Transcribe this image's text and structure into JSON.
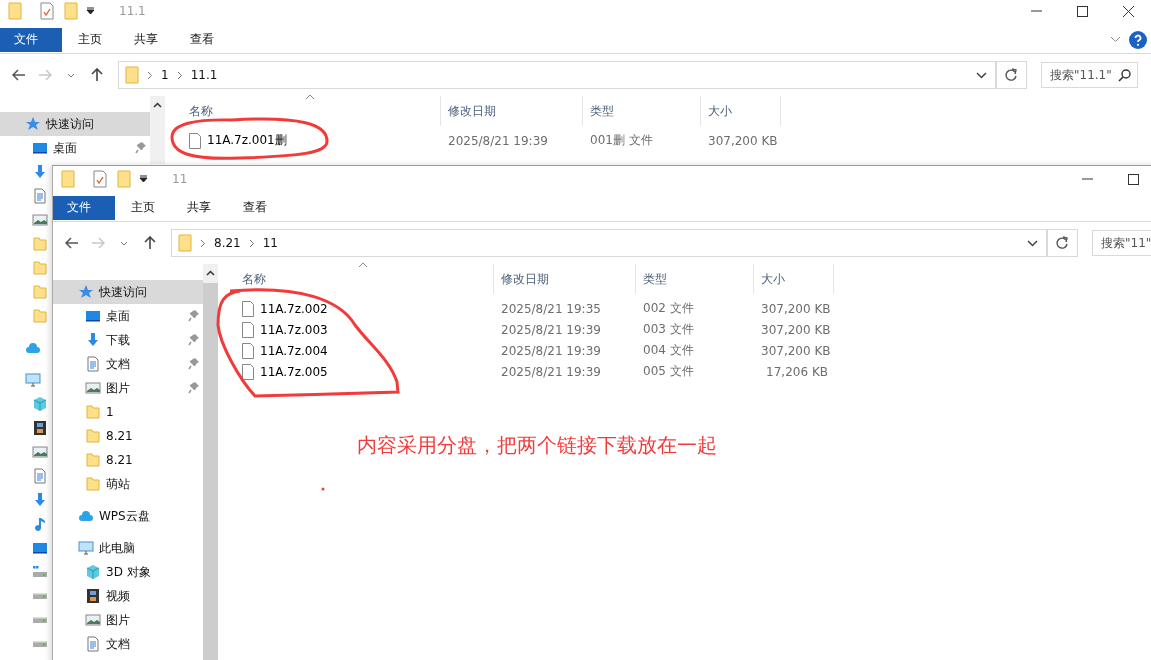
{
  "windows": [
    {
      "title": "11.1",
      "ribbon_tabs": [
        {
          "label": "文件",
          "selected": true
        },
        {
          "label": "主页",
          "selected": false
        },
        {
          "label": "共享",
          "selected": false
        },
        {
          "label": "查看",
          "selected": false
        }
      ],
      "breadcrumbs": [
        "1",
        "11.1"
      ],
      "search": {
        "placeholder": "搜索\"11.1\""
      },
      "sidebar": [
        {
          "kind": "star",
          "label": "快速访问",
          "selected": true,
          "children": [
            {
              "kind": "desktop",
              "label": "桌面",
              "selected": false,
              "pinned": true
            },
            {
              "kind": "download",
              "selected": false
            },
            {
              "kind": "document",
              "selected": false
            },
            {
              "kind": "picture",
              "selected": false
            },
            {
              "kind": "folder",
              "selected": false
            },
            {
              "kind": "folder",
              "selected": false
            },
            {
              "kind": "folder",
              "selected": false
            },
            {
              "kind": "folder",
              "selected": false
            }
          ]
        },
        {
          "kind": "cloud",
          "selected": false
        },
        {
          "kind": "computer",
          "selected": false,
          "children": [
            {
              "kind": "cube",
              "selected": false
            },
            {
              "kind": "video",
              "selected": false
            },
            {
              "kind": "picture",
              "selected": false
            },
            {
              "kind": "document",
              "selected": false
            },
            {
              "kind": "download",
              "selected": false
            },
            {
              "kind": "music",
              "selected": false
            },
            {
              "kind": "desktop",
              "selected": false
            },
            {
              "kind": "system-drive",
              "selected": false
            },
            {
              "kind": "drive",
              "selected": false
            },
            {
              "kind": "drive",
              "selected": false
            },
            {
              "kind": "drive",
              "selected": false
            }
          ]
        }
      ],
      "columns": [
        "名称",
        "修改日期",
        "类型",
        "大小"
      ],
      "files": [
        {
          "name": "11A.7z.001删",
          "modified": "2025/8/21 19:39",
          "type": "001删 文件",
          "size": "307,200 KB"
        }
      ]
    },
    {
      "title": "11",
      "ribbon_tabs": [
        {
          "label": "文件",
          "selected": true
        },
        {
          "label": "主页",
          "selected": false
        },
        {
          "label": "共享",
          "selected": false
        },
        {
          "label": "查看",
          "selected": false
        }
      ],
      "breadcrumbs": [
        "8.21",
        "11"
      ],
      "search": {
        "placeholder": "搜索\"11\""
      },
      "sidebar": [
        {
          "kind": "star",
          "label": "快速访问",
          "selected": true,
          "children": [
            {
              "kind": "desktop",
              "label": "桌面",
              "selected": false,
              "pinned": true
            },
            {
              "kind": "download",
              "label": "下载",
              "selected": false,
              "pinned": true
            },
            {
              "kind": "document",
              "label": "文档",
              "selected": false,
              "pinned": true
            },
            {
              "kind": "picture",
              "label": "图片",
              "selected": false,
              "pinned": true
            },
            {
              "kind": "folder",
              "label": "1",
              "selected": false,
              "pinned": false
            },
            {
              "kind": "folder",
              "label": "8.21",
              "selected": false,
              "pinned": false
            },
            {
              "kind": "folder",
              "label": "8.21",
              "selected": false,
              "pinned": false
            },
            {
              "kind": "folder",
              "label": "萌站",
              "selected": false,
              "pinned": false
            }
          ]
        },
        {
          "kind": "cloud",
          "label": "WPS云盘",
          "selected": false
        },
        {
          "kind": "computer",
          "label": "此电脑",
          "selected": false,
          "children": [
            {
              "kind": "cube",
              "label": "3D 对象",
              "selected": false,
              "pinned": false
            },
            {
              "kind": "video",
              "label": "视频",
              "selected": false,
              "pinned": false
            },
            {
              "kind": "picture",
              "label": "图片",
              "selected": false,
              "pinned": false
            },
            {
              "kind": "document",
              "label": "文档",
              "selected": false,
              "pinned": false
            }
          ]
        }
      ],
      "columns": [
        "名称",
        "修改日期",
        "类型",
        "大小"
      ],
      "files": [
        {
          "name": "11A.7z.002",
          "modified": "2025/8/21 19:35",
          "type": "002 文件",
          "size": "307,200 KB"
        },
        {
          "name": "11A.7z.003",
          "modified": "2025/8/21 19:39",
          "type": "003 文件",
          "size": "307,200 KB"
        },
        {
          "name": "11A.7z.004",
          "modified": "2025/8/21 19:39",
          "type": "004 文件",
          "size": "307,200 KB"
        },
        {
          "name": "11A.7z.005",
          "modified": "2025/8/21 19:39",
          "type": "005 文件",
          "size": "17,206 KB"
        }
      ]
    }
  ],
  "annotation": {
    "text": "内容采用分盘，把两个链接下载放在一起"
  }
}
